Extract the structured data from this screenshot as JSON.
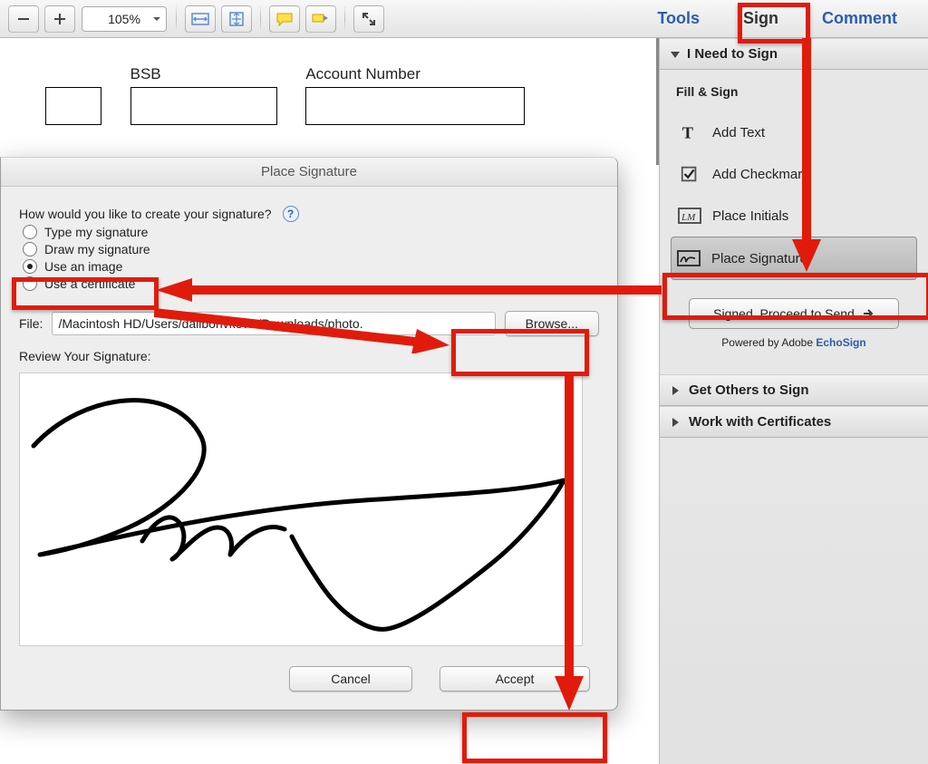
{
  "toolbar": {
    "zoom_value": "105%"
  },
  "top_links": {
    "tools": "Tools",
    "sign": "Sign",
    "comment": "Comment"
  },
  "sidebar": {
    "need_to_sign": "I Need to Sign",
    "fill_sign": "Fill & Sign",
    "add_text": "Add Text",
    "add_checkmark": "Add Checkmark",
    "place_initials": "Place Initials",
    "place_signature": "Place Signature",
    "proceed": "Signed. Proceed to Send",
    "powered_prefix": "Powered by Adobe ",
    "powered_link": "EchoSign",
    "get_others": "Get Others to Sign",
    "work_certs": "Work with Certificates"
  },
  "form": {
    "bsb_label": "BSB",
    "account_label": "Account Number"
  },
  "dialog": {
    "title": "Place Signature",
    "prompt": "How would you like to create your signature?",
    "opt_type": "Type my signature",
    "opt_draw": "Draw my signature",
    "opt_image": "Use an image",
    "opt_cert": "Use a certificate",
    "file_label": "File:",
    "file_path": "/Macintosh HD/Users/daliborivkovic/Downloads/photo.",
    "browse": "Browse...",
    "review": "Review Your Signature:",
    "cancel": "Cancel",
    "accept": "Accept"
  }
}
